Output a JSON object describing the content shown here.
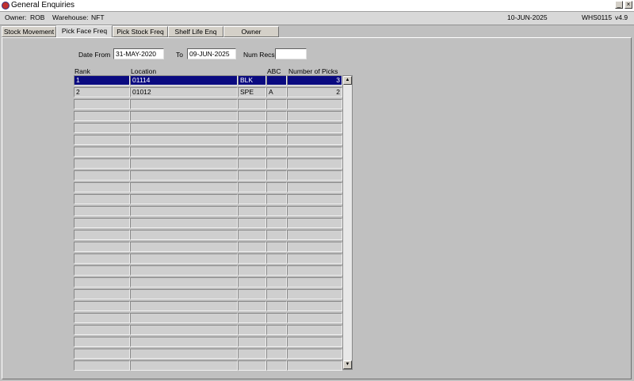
{
  "window": {
    "title": "General Enquiries",
    "minimize_glyph": "_",
    "close_glyph": "×"
  },
  "infobar": {
    "owner_label": "Owner:",
    "owner_value": "ROB",
    "warehouse_label": "Warehouse:",
    "warehouse_value": "NFT",
    "date": "10-JUN-2025",
    "program": "WHS0115",
    "version": "v4.9"
  },
  "tabs": [
    {
      "label": "Stock Movement"
    },
    {
      "label": "Pick Face Freq"
    },
    {
      "label": "Pick Stock Freq"
    },
    {
      "label": "Shelf Life Enq"
    },
    {
      "label": "Owner"
    }
  ],
  "active_tab": "Pick Face Freq",
  "filters": {
    "date_from_label": "Date From",
    "date_from_value": "31-MAY-2020",
    "to_label": "To",
    "to_value": "09-JUN-2025",
    "num_recs_label": "Num Recs",
    "num_recs_value": ""
  },
  "table": {
    "columns": [
      "Rank",
      "Location",
      "",
      "ABC",
      "Number of Picks"
    ],
    "rows": [
      {
        "rank": "1",
        "location": "01114",
        "type": "BLK",
        "abc": "",
        "picks": "3"
      },
      {
        "rank": "2",
        "location": "01012",
        "type": "SPE",
        "abc": "A",
        "picks": "2"
      }
    ],
    "selected_row": 0
  },
  "colors": {
    "selection": "#0a0a80",
    "background": "#c0c0c0"
  }
}
